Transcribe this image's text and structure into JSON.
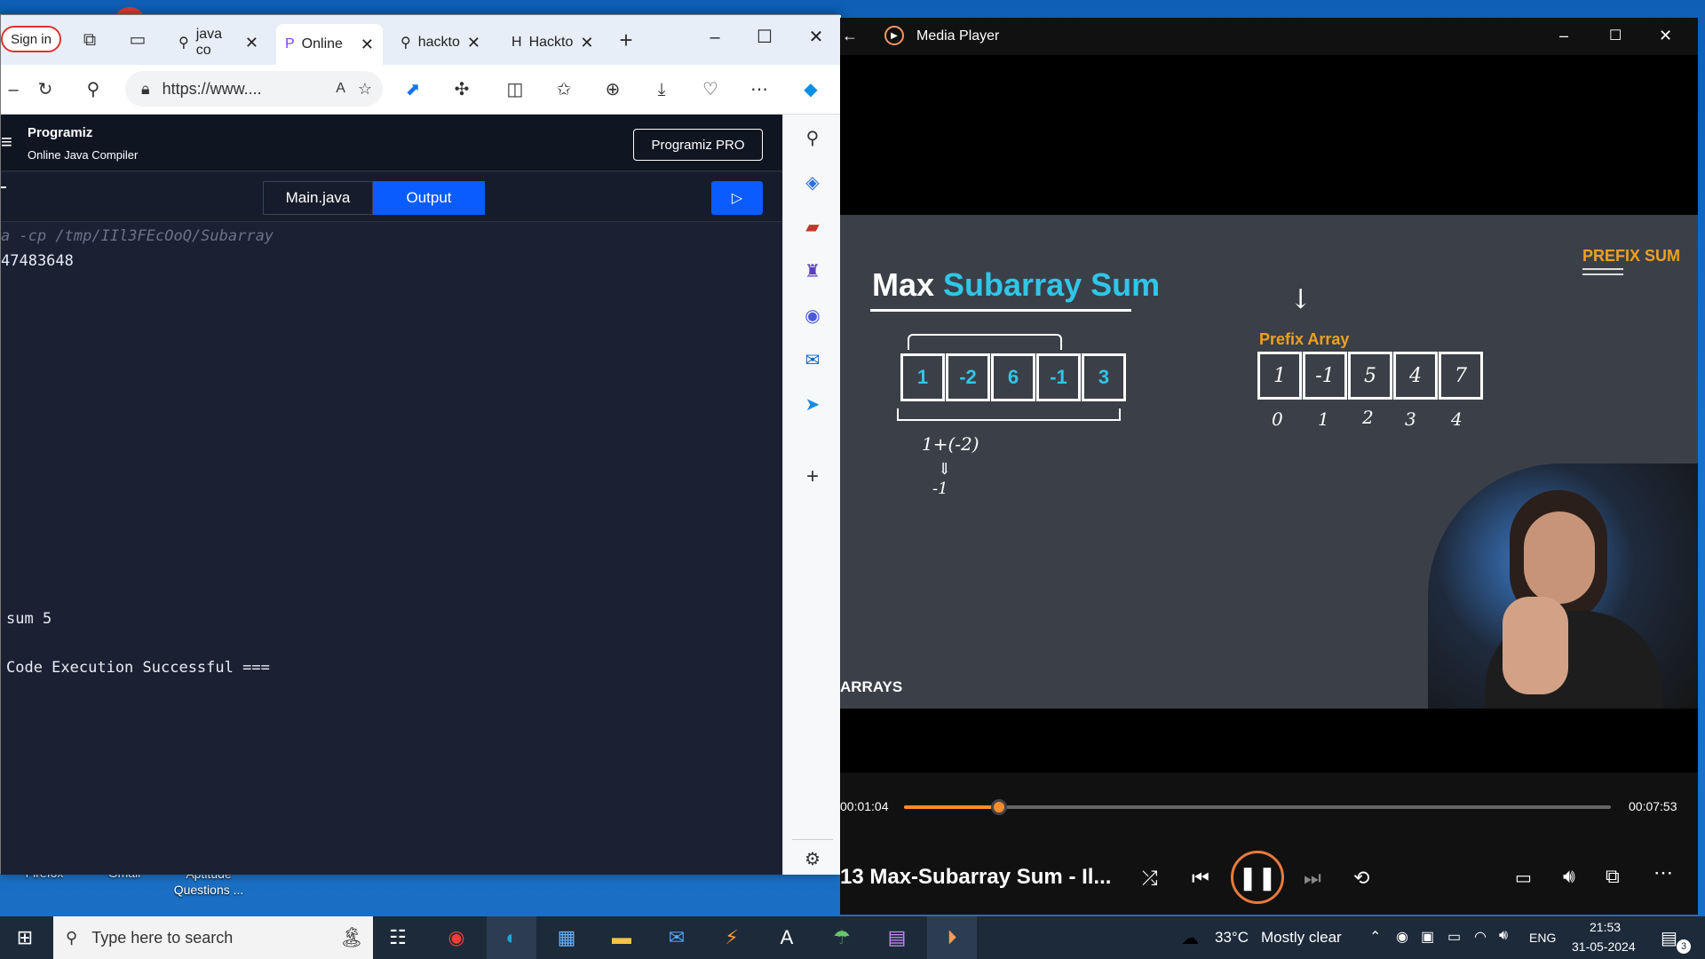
{
  "desktop": {
    "icons": [
      {
        "label": "Firefox"
      },
      {
        "label": "Gmail"
      },
      {
        "label": "Aptitude Questions ..."
      }
    ]
  },
  "browser": {
    "sign_in": "Sign in",
    "tabs": [
      {
        "label": "java co"
      },
      {
        "label": "Online"
      },
      {
        "label": "hackto"
      },
      {
        "label": "Hackto"
      }
    ],
    "url": "https://www....",
    "site": {
      "logo": "Programiz",
      "subtitle": "Online Java Compiler",
      "pro_button": "Programiz PRO",
      "file_tab": "Main.java",
      "output_tab": "Output"
    },
    "console": {
      "lines": [
        "a -cp /tmp/IIl3FEcOoQ/Subarray",
        "47483648",
        "sum 5",
        "Code Execution Successful ==="
      ]
    }
  },
  "player": {
    "title": "Media Player",
    "video": {
      "heading_white": "Max",
      "heading_cyan": "Subarray Sum",
      "corner_label": "PREFIX SUM",
      "footer_label": "ARRAYS",
      "array_values": [
        "1",
        "-2",
        "6",
        "-1",
        "3"
      ],
      "prefix_label": "Prefix Array",
      "prefix_values": [
        "1",
        "-1",
        "5",
        "4",
        "7"
      ],
      "indices": [
        "0",
        "1",
        "2",
        "3",
        "4"
      ],
      "annotation_1": "1+(-2)",
      "annotation_2": "⇓",
      "annotation_3": "-1"
    },
    "time_current": "00:01:04",
    "time_total": "00:07:53",
    "progress": 0.135,
    "now_playing": "13 Max-Subarray Sum - Il..."
  },
  "taskbar": {
    "search_placeholder": "Type here to search",
    "weather_temp": "33°C",
    "weather_desc": "Mostly clear",
    "lang": "ENG",
    "time": "21:53",
    "date": "31-05-2024",
    "notif_count": "3"
  },
  "colors": {
    "accent_blue": "#0a5cff",
    "cyan": "#2fc6e8",
    "orange": "#f0a020",
    "progress": "#ff8c2a"
  }
}
